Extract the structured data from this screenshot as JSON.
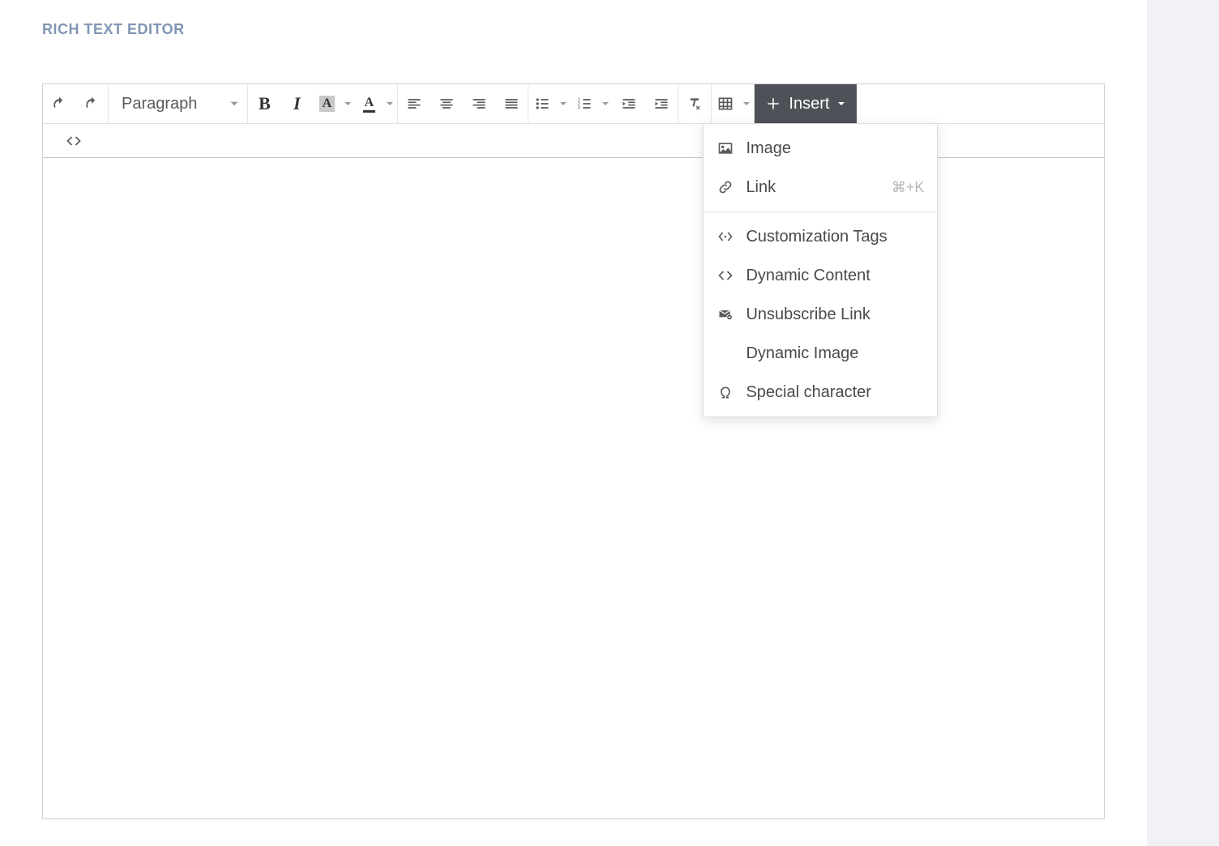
{
  "section_title": "RICH TEXT EDITOR",
  "toolbar": {
    "format_dropdown": {
      "label": "Paragraph"
    },
    "insert_button": {
      "label": "Insert"
    }
  },
  "insert_menu": {
    "group1": [
      {
        "key": "image",
        "label": "Image",
        "shortcut": ""
      },
      {
        "key": "link",
        "label": "Link",
        "shortcut": "⌘+K"
      }
    ],
    "group2": [
      {
        "key": "customization_tags",
        "label": "Customization Tags"
      },
      {
        "key": "dynamic_content",
        "label": "Dynamic Content"
      },
      {
        "key": "unsubscribe_link",
        "label": "Unsubscribe Link"
      },
      {
        "key": "dynamic_image",
        "label": "Dynamic Image"
      },
      {
        "key": "special_character",
        "label": "Special character"
      }
    ]
  }
}
